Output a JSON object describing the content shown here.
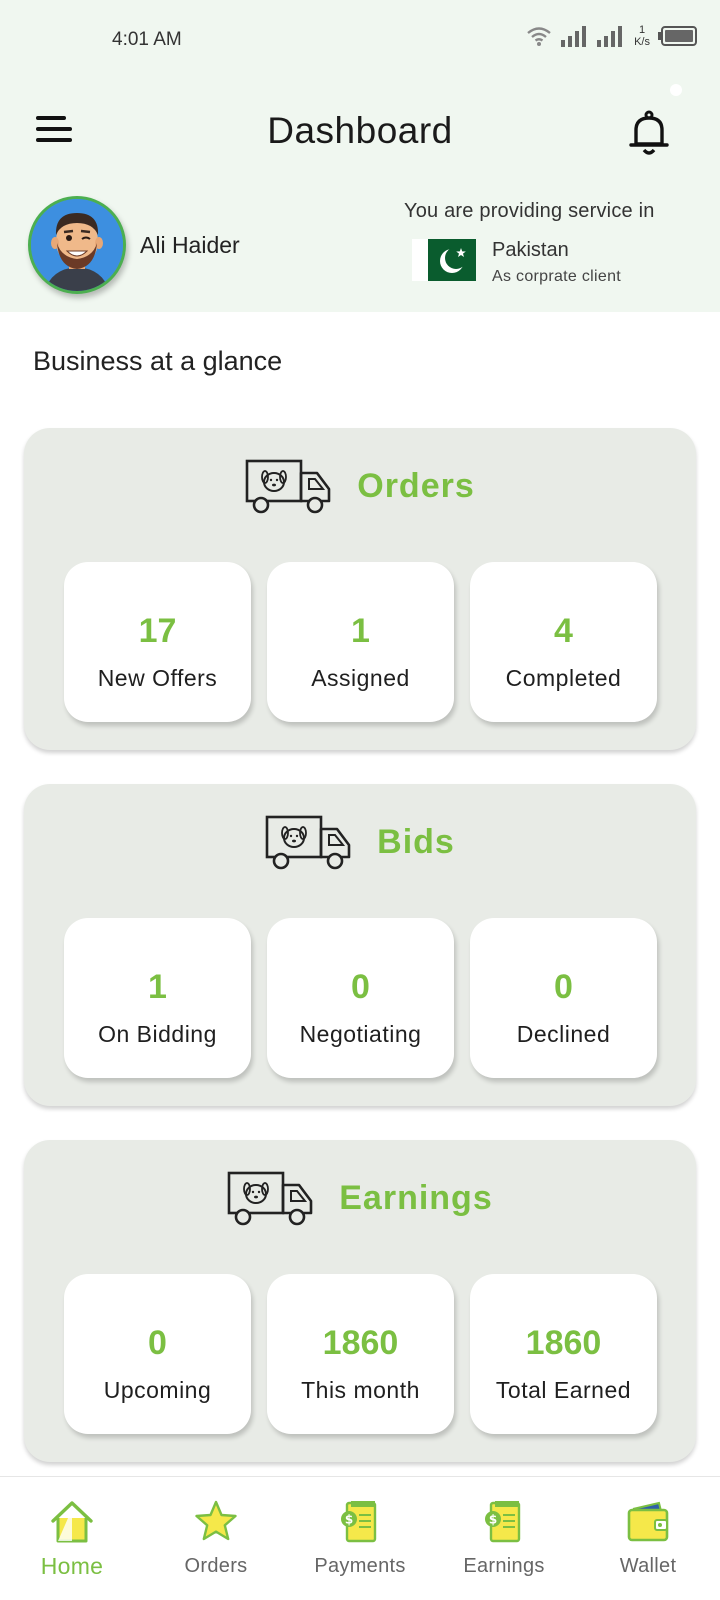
{
  "status_bar": {
    "time": "4:01 AM",
    "speed_value": "1",
    "speed_unit": "K/s"
  },
  "header": {
    "title": "Dashboard"
  },
  "profile": {
    "name": "Ali Haider"
  },
  "service": {
    "label": "You are providing service in",
    "country": "Pakistan",
    "client_type": "As corprate client"
  },
  "section_title": "Business at a glance",
  "cards": [
    {
      "title": "Orders",
      "stats": [
        {
          "value": "17",
          "label": "New Offers"
        },
        {
          "value": "1",
          "label": "Assigned"
        },
        {
          "value": "4",
          "label": "Completed"
        }
      ]
    },
    {
      "title": "Bids",
      "stats": [
        {
          "value": "1",
          "label": "On Bidding"
        },
        {
          "value": "0",
          "label": "Negotiating"
        },
        {
          "value": "0",
          "label": "Declined"
        }
      ]
    },
    {
      "title": "Earnings",
      "stats": [
        {
          "value": "0",
          "label": "Upcoming"
        },
        {
          "value": "1860",
          "label": "This month"
        },
        {
          "value": "1860",
          "label": "Total Earned"
        }
      ]
    }
  ],
  "bottom_nav": [
    {
      "label": "Home",
      "icon": "home-icon",
      "active": true
    },
    {
      "label": "Orders",
      "icon": "star-icon",
      "active": false
    },
    {
      "label": "Payments",
      "icon": "payments-icon",
      "active": false
    },
    {
      "label": "Earnings",
      "icon": "earnings-icon",
      "active": false
    },
    {
      "label": "Wallet",
      "icon": "wallet-icon",
      "active": false
    }
  ],
  "colors": {
    "accent": "#7bbf42",
    "header_bg": "#f0f7f0",
    "card_bg": "#e8ebe6"
  }
}
